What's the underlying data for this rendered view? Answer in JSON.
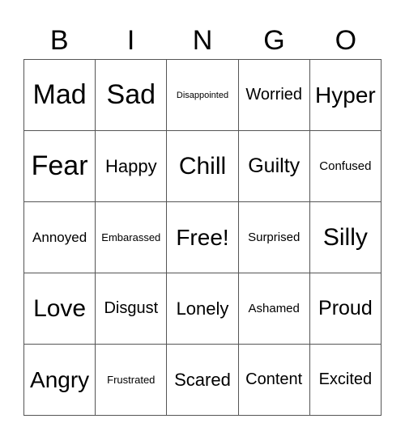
{
  "title_letters": [
    "B",
    "I",
    "N",
    "G",
    "O"
  ],
  "board": {
    "rows": [
      [
        "Mad",
        "Sad",
        "Disappointed",
        "Worried",
        "Hyper"
      ],
      [
        "Fear",
        "Happy",
        "Chill",
        "Guilty",
        "Confused"
      ],
      [
        "Annoyed",
        "Embarassed",
        "Free!",
        "Surprised",
        "Silly"
      ],
      [
        "Love",
        "Disgust",
        "Lonely",
        "Ashamed",
        "Proud"
      ],
      [
        "Angry",
        "Frustrated",
        "Scared",
        "Content",
        "Excited"
      ]
    ]
  }
}
